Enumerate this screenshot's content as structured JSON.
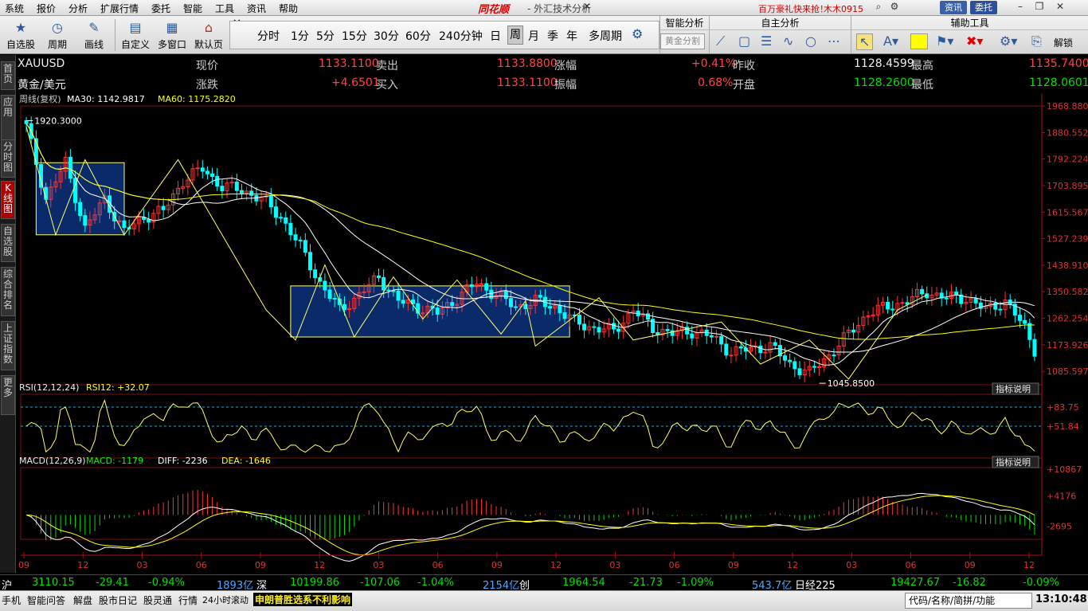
{
  "menu": [
    "系统",
    "报价",
    "分析",
    "扩展行情",
    "委托",
    "智能",
    "工具",
    "资讯",
    "帮助"
  ],
  "brand": "同花顺",
  "app_title": "- 外汇技术分析",
  "promo": "百万豪礼快来抢！",
  "user": "木木0915",
  "top_buttons": [
    "资讯",
    "委托"
  ],
  "toolbar": {
    "left_tools": [
      {
        "label": "自选股",
        "icon": "star-icon"
      },
      {
        "label": "周期",
        "icon": "period-icon"
      },
      {
        "label": "画线",
        "icon": "pen-icon"
      },
      {
        "label": "自定义",
        "icon": "custom-icon"
      },
      {
        "label": "多窗口",
        "icon": "window-icon"
      },
      {
        "label": "默认页",
        "icon": "home-icon"
      }
    ],
    "periods": [
      "分时",
      "1分",
      "5分",
      "15分",
      "30分",
      "60分",
      "240分钟",
      "日",
      "周",
      "月",
      "季",
      "年",
      "多周期"
    ],
    "active_period": "周",
    "smart_analysis": "智能分析",
    "split_button": "黄金分割",
    "self_analysis": "自主分析",
    "aux_tools": "辅助工具",
    "unlock": "解锁"
  },
  "left_tabs": [
    "首页",
    "应用",
    "分时图",
    "K线图",
    "自选股",
    "综合排名",
    "上证指数",
    "更多"
  ],
  "quote": {
    "symbol": "XAUUSD",
    "name": "黄金/美元",
    "fields": [
      {
        "label": "现价",
        "value": "1133.1100",
        "color": "red"
      },
      {
        "label": "卖出",
        "value": "1133.8800",
        "color": "red"
      },
      {
        "label": "涨幅",
        "value": "+0.41%",
        "color": "red"
      },
      {
        "label": "昨收",
        "value": "1128.4599",
        "color": "white"
      },
      {
        "label": "最高",
        "value": "1135.7400",
        "color": "red"
      },
      {
        "label": "涨跌",
        "value": "+4.6501",
        "color": "red"
      },
      {
        "label": "买入",
        "value": "1133.1100",
        "color": "red"
      },
      {
        "label": "振幅",
        "value": "0.68%",
        "color": "red"
      },
      {
        "label": "开盘",
        "value": "1128.2600",
        "color": "green"
      },
      {
        "label": "最低",
        "value": "1128.0601",
        "color": "green"
      }
    ]
  },
  "chart_data": {
    "type": "candlestick",
    "title": "周线(复权)",
    "ma_labels": [
      {
        "text": "MA30: 1142.9817",
        "color": "#ffffff"
      },
      {
        "text": "MA60: 1175.2820",
        "color": "#ffff00"
      }
    ],
    "y_ticks": [
      "1968.880",
      "1880.552",
      "1792.224",
      "1703.895",
      "1615.567",
      "1527.239",
      "1438.910",
      "1350.582",
      "1262.254",
      "1173.926",
      "1085.597"
    ],
    "ylim": [
      1041.0,
      1968.88
    ],
    "x_ticks": [
      "09",
      "12",
      "03",
      "06",
      "09",
      "12",
      "03",
      "06",
      "09",
      "12",
      "03",
      "06",
      "09",
      "12",
      "03",
      "06",
      "09",
      "12"
    ],
    "annotations": [
      {
        "text": "1920.3000"
      },
      {
        "text": "1045.8500"
      }
    ],
    "close_anchors": [
      [
        0,
        1900
      ],
      [
        4,
        1660
      ],
      [
        8,
        1780
      ],
      [
        12,
        1560
      ],
      [
        16,
        1660
      ],
      [
        20,
        1550
      ],
      [
        24,
        1600
      ],
      [
        28,
        1620
      ],
      [
        32,
        1720
      ],
      [
        36,
        1760
      ],
      [
        40,
        1700
      ],
      [
        44,
        1690
      ],
      [
        48,
        1660
      ],
      [
        52,
        1600
      ],
      [
        56,
        1500
      ],
      [
        60,
        1380
      ],
      [
        64,
        1290
      ],
      [
        68,
        1340
      ],
      [
        72,
        1400
      ],
      [
        76,
        1320
      ],
      [
        80,
        1300
      ],
      [
        84,
        1280
      ],
      [
        88,
        1330
      ],
      [
        92,
        1380
      ],
      [
        96,
        1340
      ],
      [
        100,
        1300
      ],
      [
        104,
        1320
      ],
      [
        108,
        1300
      ],
      [
        112,
        1250
      ],
      [
        116,
        1230
      ],
      [
        120,
        1220
      ],
      [
        124,
        1290
      ],
      [
        128,
        1230
      ],
      [
        132,
        1210
      ],
      [
        136,
        1220
      ],
      [
        140,
        1200
      ],
      [
        144,
        1150
      ],
      [
        148,
        1160
      ],
      [
        152,
        1170
      ],
      [
        156,
        1110
      ],
      [
        160,
        1080
      ],
      [
        164,
        1140
      ],
      [
        168,
        1210
      ],
      [
        172,
        1280
      ],
      [
        176,
        1300
      ],
      [
        180,
        1320
      ],
      [
        184,
        1350
      ],
      [
        188,
        1330
      ],
      [
        192,
        1330
      ],
      [
        196,
        1290
      ],
      [
        200,
        1320
      ],
      [
        204,
        1230
      ],
      [
        206,
        1160
      ]
    ],
    "rsi": {
      "label": "RSI(12,12,24)",
      "value_label": "RSI12: +32.07",
      "ticks": [
        "+83.75",
        "+51.84"
      ]
    },
    "macd": {
      "label": "MACD(12,26,9)",
      "macd_label": "MACD: -1179",
      "diff_label": "DIFF: -2236",
      "dea_label": "DEA: -1646",
      "ticks": [
        "+10867",
        "+4176",
        "-2695"
      ]
    },
    "indicator_button": "指标说明"
  },
  "ticker": [
    {
      "text": "沪",
      "color": "#ffffff"
    },
    {
      "text": "3110.15",
      "color": "#00e000"
    },
    {
      "text": "-29.41",
      "color": "#00e000"
    },
    {
      "text": "-0.94%",
      "color": "#00e000"
    },
    {
      "text": "1893亿",
      "color": "#4aa8ff"
    },
    {
      "text": "深",
      "color": "#ffffff"
    },
    {
      "text": "10199.86",
      "color": "#00e000"
    },
    {
      "text": "-107.06",
      "color": "#00e000"
    },
    {
      "text": "-1.04%",
      "color": "#00e000"
    },
    {
      "text": "2154亿",
      "color": "#4aa8ff"
    },
    {
      "text": "创",
      "color": "#ffffff"
    },
    {
      "text": "1964.54",
      "color": "#00e000"
    },
    {
      "text": "-21.73",
      "color": "#00e000"
    },
    {
      "text": "-1.09%",
      "color": "#00e000"
    },
    {
      "text": "543.7亿",
      "color": "#4aa8ff"
    },
    {
      "text": "日经225",
      "color": "#ffffff"
    },
    {
      "text": "19427.67",
      "color": "#00e000"
    },
    {
      "text": "-16.82",
      "color": "#00e000"
    },
    {
      "text": "-0.09%",
      "color": "#00e000"
    }
  ],
  "status": {
    "items": [
      "手机",
      "智能问答",
      "解盘",
      "股市日记",
      "股灵通",
      "行情"
    ],
    "scroll_label": "24小时滚动",
    "scroll_text": "申朗普胜选系不利影响",
    "search_placeholder": "代码/名称/简拼/功能",
    "clock": "13:10:48"
  },
  "colors": {
    "up": "#ff3333",
    "down": "#00ffff",
    "ma30": "#ffffff",
    "ma60": "#ffff00",
    "box": "#0b2a6a"
  }
}
